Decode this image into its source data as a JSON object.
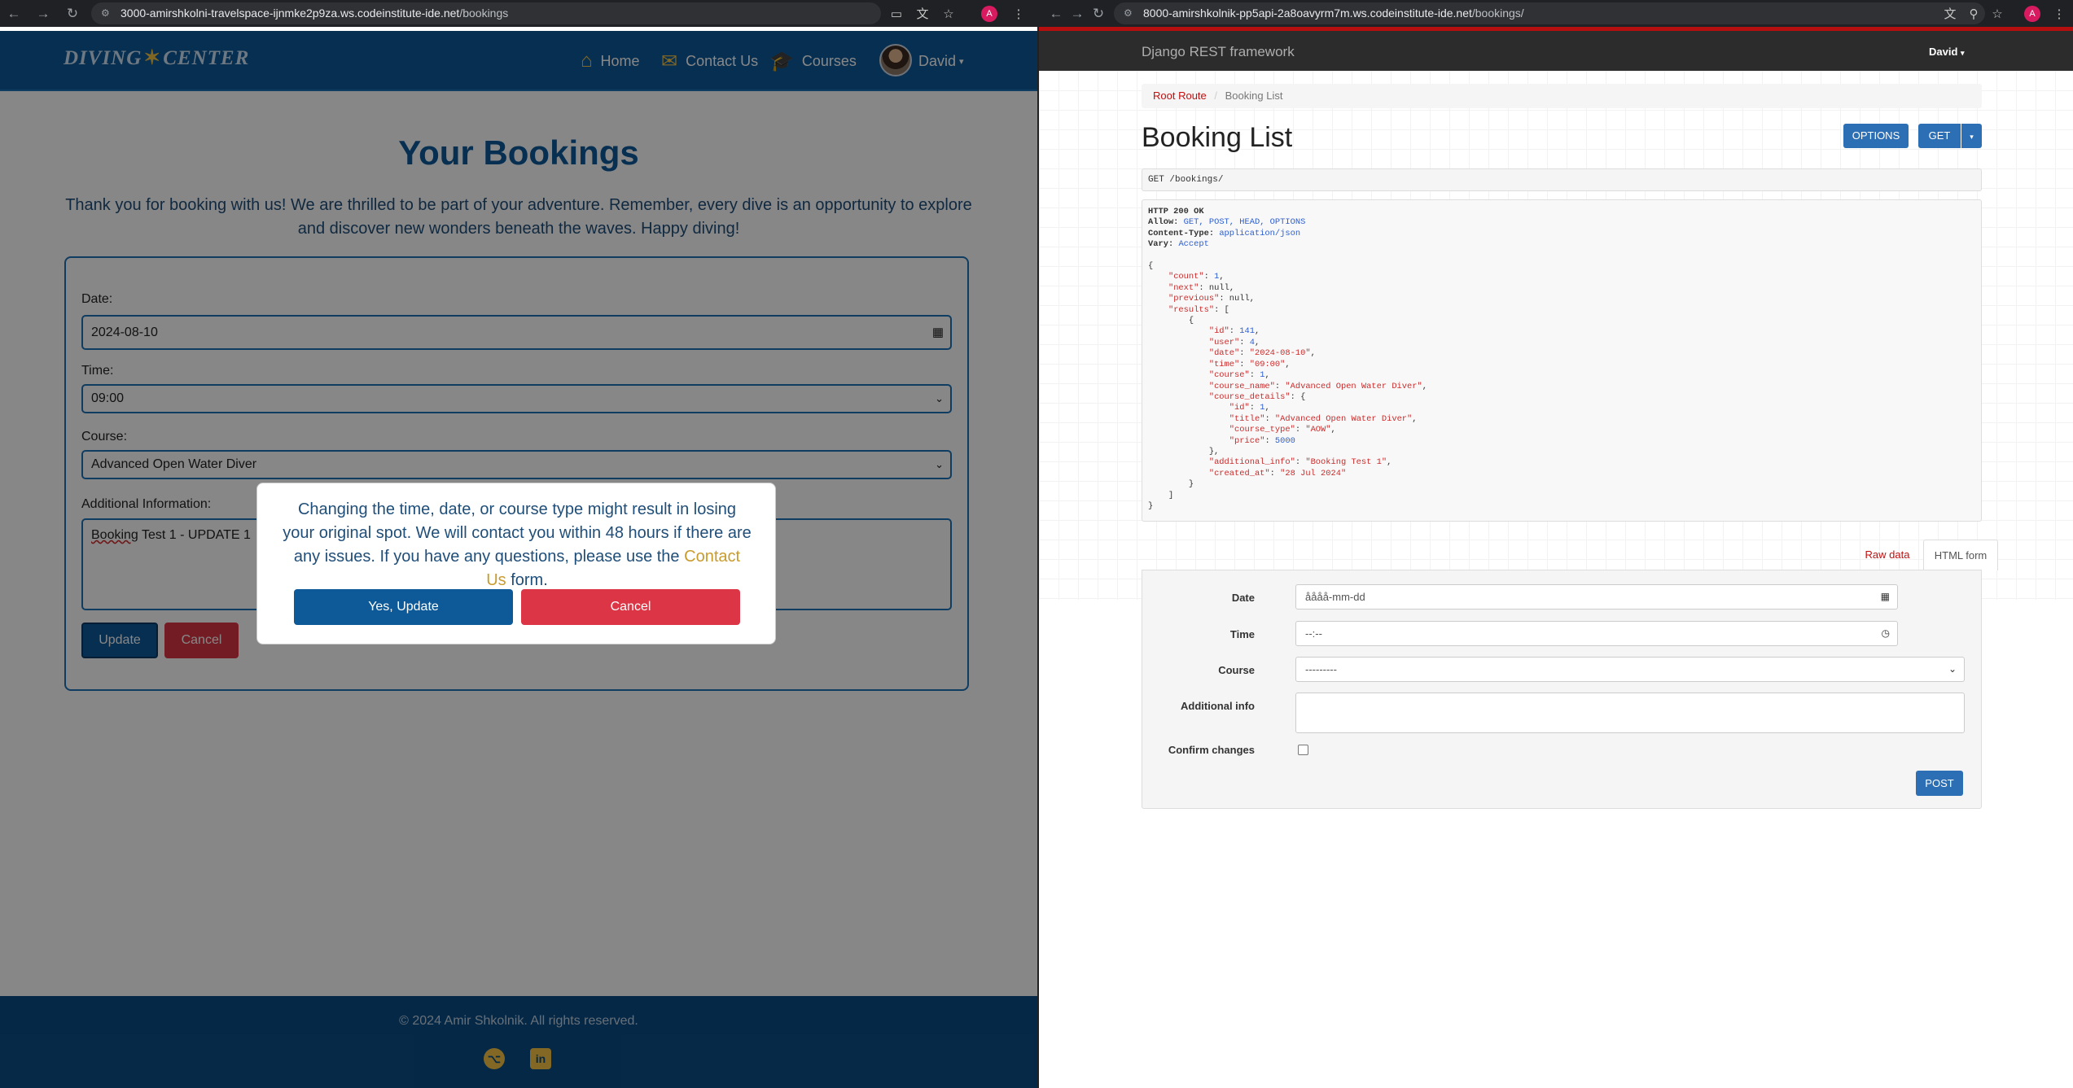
{
  "left_browser": {
    "url_host": "3000-amirshkolni-travelspace-ijnmke2p9za.ws.codeinstitute-ide.net",
    "url_path": "/bookings",
    "profile_initial": "A"
  },
  "site": {
    "logo_text_1": "DIVING",
    "logo_text_2": "CENTER",
    "nav": {
      "home": "Home",
      "contact": "Contact Us",
      "courses": "Courses",
      "user": "David"
    },
    "page_title": "Your Bookings",
    "intro": "Thank you for booking with us! We are thrilled to be part of your adventure. Remember, every dive is an opportunity to explore and discover new wonders beneath the waves. Happy diving!",
    "form": {
      "date_label": "Date:",
      "date_value": "2024-08-10",
      "time_label": "Time:",
      "time_value": "09:00",
      "course_label": "Course:",
      "course_value": "Advanced Open Water Diver",
      "info_label": "Additional Information:",
      "info_value_word": "Booking",
      "info_value_rest": " Test 1 - UPDATE 1",
      "update_button": "Update",
      "cancel_button": "Cancel"
    },
    "modal": {
      "text_before": "Changing the time, date, or course type might result in losing your original spot. We will contact you within 48 hours if there are any issues. If you have any questions, please use the ",
      "contact_link": "Contact Us",
      "text_after": " form.",
      "confirm_button": "Yes, Update",
      "cancel_button": "Cancel"
    },
    "footer": {
      "copyright": "© 2024 Amir Shkolnik. All rights reserved."
    }
  },
  "right_browser": {
    "url_host": "8000-amirshkolnik-pp5api-2a8oavyrm7m.ws.codeinstitute-ide.net",
    "url_path": "/bookings/",
    "profile_initial": "A"
  },
  "drf": {
    "brand": "Django REST framework",
    "user": "David",
    "breadcrumb_root": "Root Route",
    "breadcrumb_current": "Booking List",
    "title": "Booking List",
    "options_button": "OPTIONS",
    "get_button": "GET",
    "request_line": "GET /bookings/",
    "response": {
      "status": "HTTP 200 OK",
      "allow": "GET, POST, HEAD, OPTIONS",
      "content_type": "application/json",
      "vary": "Accept",
      "count": "1",
      "next": "null",
      "previous": "null",
      "id": "141",
      "user": "4",
      "date": "\"2024-08-10\"",
      "time": "\"09:00\"",
      "course": "1",
      "course_name": "\"Advanced Open Water Diver\"",
      "cd_id": "1",
      "cd_title": "\"Advanced Open Water Diver\"",
      "cd_course_type": "\"AOW\"",
      "cd_price": "5000",
      "additional_info": "\"Booking Test 1\"",
      "created_at": "\"28 Jul 2024\""
    },
    "tab_raw": "Raw data",
    "tab_html": "HTML form",
    "form": {
      "date_label": "Date",
      "date_placeholder": "åååå-mm-dd",
      "time_label": "Time",
      "time_placeholder": "--:--",
      "course_label": "Course",
      "course_value": "---------",
      "info_label": "Additional info",
      "confirm_label": "Confirm changes",
      "post_button": "POST"
    }
  }
}
